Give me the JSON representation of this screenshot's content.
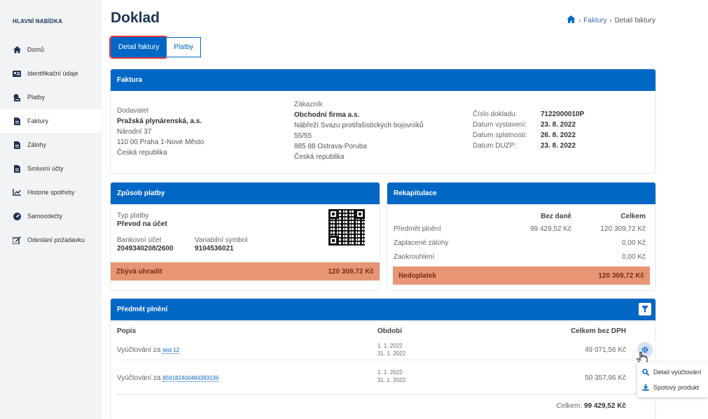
{
  "sidebar": {
    "title": "HLAVNÍ NABÍDKA",
    "items": [
      {
        "label": "Domů",
        "icon": "home-icon"
      },
      {
        "label": "Identifikační údaje",
        "icon": "id-card-icon"
      },
      {
        "label": "Platby",
        "icon": "payments-icon"
      },
      {
        "label": "Faktury",
        "icon": "document-icon"
      },
      {
        "label": "Zálohy",
        "icon": "document-icon"
      },
      {
        "label": "Smluvní účty",
        "icon": "document-icon"
      },
      {
        "label": "Historie spotřeby",
        "icon": "chart-icon"
      },
      {
        "label": "Samoodečty",
        "icon": "meter-icon"
      },
      {
        "label": "Odeslání požadavku",
        "icon": "edit-icon"
      }
    ],
    "active_index": 3
  },
  "header": {
    "title": "Doklad",
    "breadcrumb": [
      "Faktury",
      "Detail faktury"
    ]
  },
  "tabs": [
    "Detail faktury",
    "Platby"
  ],
  "invoice": {
    "heading": "Faktura",
    "supplier": {
      "label": "Dodavatel",
      "name": "Pražská plynárenská, a.s.",
      "lines": [
        "Národní 37",
        "110 00 Praha 1-Nové Město",
        "Česká republika"
      ]
    },
    "customer": {
      "label": "Zákazník",
      "name": "Obchodní firma a.s.",
      "lines": [
        "Nábřeží Svazu protifašistických bojovníků",
        "55/55",
        "885 88 Ostrava-Poruba",
        "Česká republika"
      ]
    },
    "details": [
      {
        "label": "Číslo dokladu:",
        "value": "7122000010P"
      },
      {
        "label": "Datum vystavení:",
        "value": "23. 8. 2022"
      },
      {
        "label": "Datum splatnosti:",
        "value": "26. 8. 2022"
      },
      {
        "label": "Datum DUZP:",
        "value": "23. 8. 2022"
      }
    ]
  },
  "payment": {
    "heading": "Způsob platby",
    "type_label": "Typ platby",
    "type_value": "Převod na účet",
    "account_label": "Bankovní účet",
    "account_value": "2049340208/2600",
    "vs_label": "Variabilní symbol",
    "vs_value": "9104536021",
    "due_label": "Zbývá uhradit",
    "due_value": "120 309,72 Kč"
  },
  "recap": {
    "heading": "Rekapitulace",
    "col_net": "Bez daně",
    "col_total": "Celkem",
    "rows": [
      {
        "label": "Předmět plnění",
        "net": "99 429,52 Kč",
        "total": "120 309,72 Kč"
      },
      {
        "label": "Zaplacené zálohy",
        "net": "",
        "total": "0,00 Kč"
      },
      {
        "label": "Zaokrouhlení",
        "net": "",
        "total": "0,00 Kč"
      }
    ],
    "balance_label": "Nedoplatek",
    "balance_value": "120 309,72 Kč"
  },
  "items": {
    "heading": "Předmět plnění",
    "col_desc": "Popis",
    "col_period": "Období",
    "col_total": "Celkem bez DPH",
    "rows": [
      {
        "prefix": "Vyúčtování za",
        "link": "test 12",
        "from": "1. 1. 2022",
        "to": "31. 1. 2022",
        "amount": "49 071,56 Kč"
      },
      {
        "prefix": "Vyúčtování za",
        "link": "859182400484393136",
        "from": "1. 1. 2022",
        "to": "31. 1. 2022",
        "amount": "50 357,96 Kč"
      }
    ],
    "sum_label": "Celkem:",
    "sum_value": "99 429,52 Kč"
  },
  "context_menu": [
    "Detail vyúčtování",
    "Spotový produkt"
  ],
  "colors": {
    "accent": "#0067c5",
    "due": "#e79575",
    "heading": "#1d3557",
    "highlight": "#e53935"
  }
}
